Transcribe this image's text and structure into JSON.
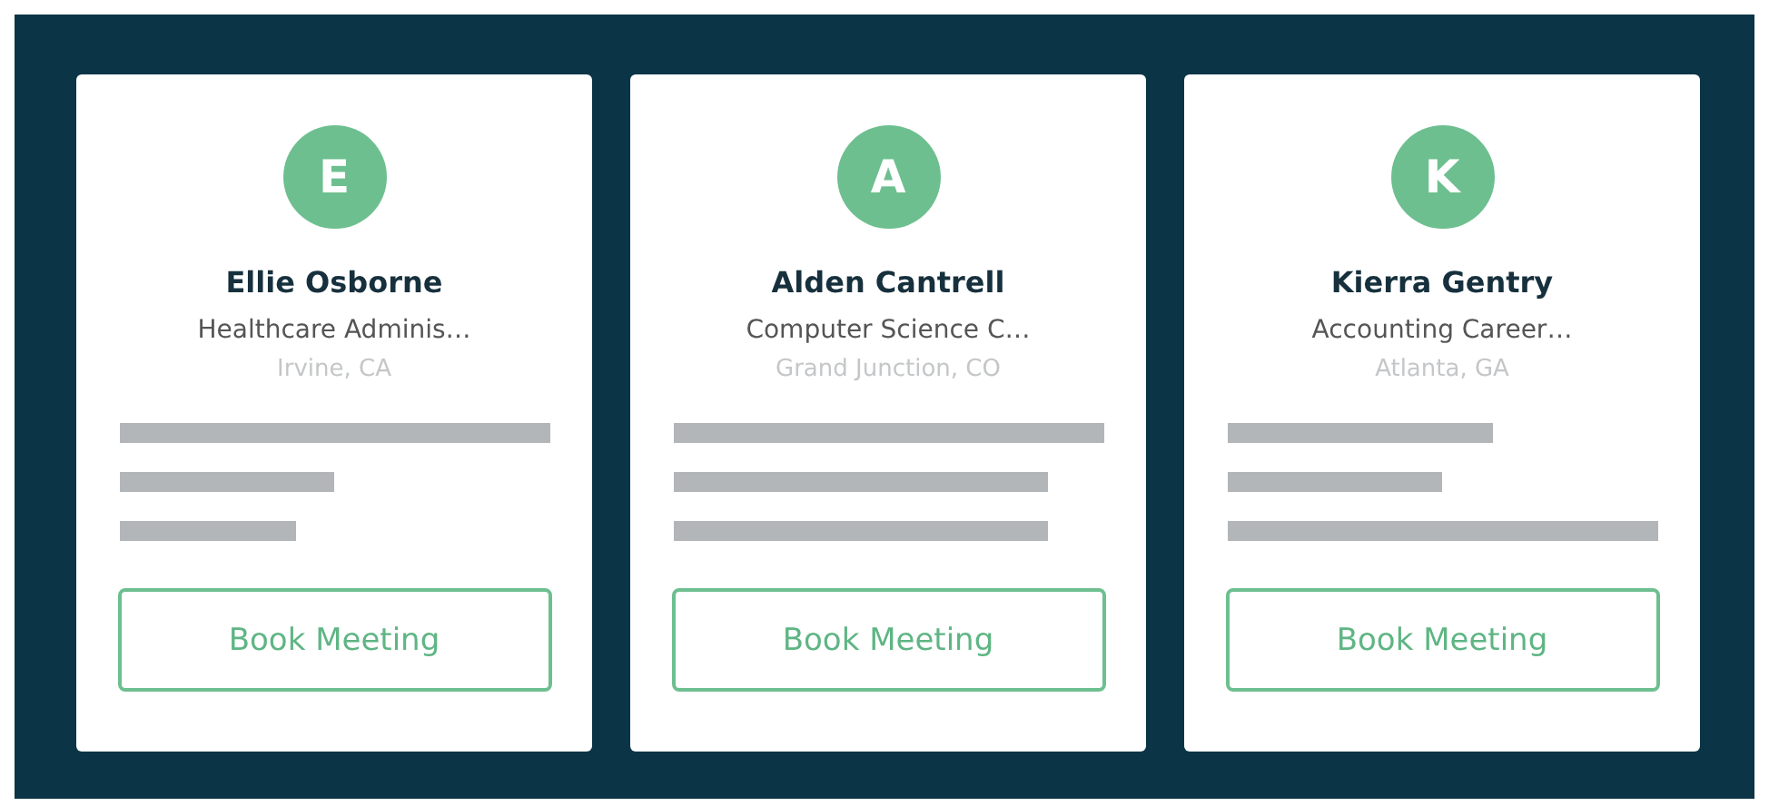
{
  "cards": [
    {
      "initial": "E",
      "name": "Ellie Osborne",
      "title": "Healthcare Adminis…",
      "location": "Irvine, CA",
      "button": "Book Meeting"
    },
    {
      "initial": "A",
      "name": "Alden Cantrell",
      "title": "Computer Science C…",
      "location": "Grand Junction, CO",
      "button": "Book Meeting"
    },
    {
      "initial": "K",
      "name": "Kierra Gentry",
      "title": "Accounting Career…",
      "location": "Atlanta, GA",
      "button": "Book Meeting"
    }
  ]
}
